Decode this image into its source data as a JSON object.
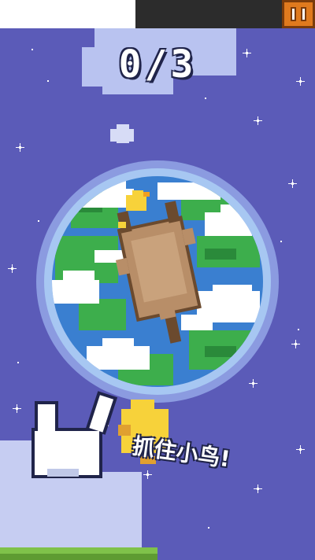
{
  "hud": {
    "caught_count": "0/3",
    "pause_icon": "pause-icon"
  },
  "tutorial": {
    "instruction": "抓住小鸟!",
    "hand_icon": "pointing-hand-icon"
  },
  "colors": {
    "sky": "#5b5bb8",
    "ocean": "#3a7fd0",
    "land": "#3dae4c",
    "cloud": "#ffffff",
    "cat_body": "#b88e68",
    "cat_dark": "#6b4a2e",
    "bird": "#f7d23a",
    "pause_button": "#e07a1e"
  }
}
